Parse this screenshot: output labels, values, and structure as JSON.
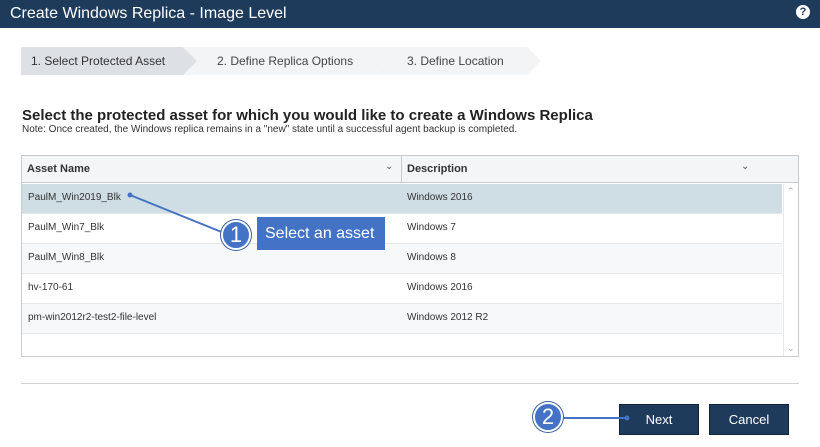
{
  "window": {
    "title": "Create Windows Replica - Image Level",
    "help_glyph": "?"
  },
  "steps": [
    {
      "label": "1. Select Protected Asset",
      "active": true
    },
    {
      "label": "2. Define Replica Options",
      "active": false
    },
    {
      "label": "3. Define Location",
      "active": false
    }
  ],
  "content": {
    "heading": "Select the protected asset for which you would like to create a Windows Replica",
    "note": "Note: Once created, the Windows replica remains in a \"new\" state until a successful agent backup is completed."
  },
  "table": {
    "columns": [
      "Asset Name",
      "Description"
    ],
    "rows": [
      {
        "asset": "PaulM_Win2019_Blk",
        "description": "Windows 2016",
        "selected": true
      },
      {
        "asset": "PaulM_Win7_Blk",
        "description": "Windows 7",
        "selected": false
      },
      {
        "asset": "PaulM_Win8_Blk",
        "description": "Windows 8",
        "selected": false
      },
      {
        "asset": "hv-170-61",
        "description": "Windows 2016",
        "selected": false
      },
      {
        "asset": "pm-win2012r2-test2-file-level",
        "description": "Windows 2012 R2",
        "selected": false
      }
    ]
  },
  "buttons": {
    "next": "Next",
    "cancel": "Cancel"
  },
  "callouts": {
    "one_number": "1",
    "one_label": "Select an asset",
    "two_number": "2"
  },
  "colors": {
    "titlebar": "#1e3b5c",
    "selected_row": "#cfdde4",
    "callout": "#4472c4"
  }
}
